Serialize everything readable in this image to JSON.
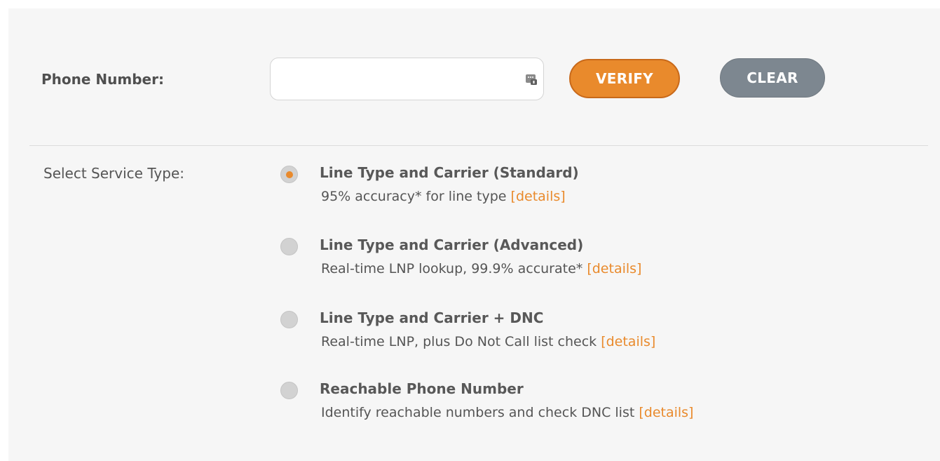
{
  "form": {
    "phone_label": "Phone Number:",
    "phone_value": "",
    "phone_placeholder": "",
    "contact_icon": "contact-card-icon",
    "verify_label": "VERIFY",
    "clear_label": "CLEAR"
  },
  "service": {
    "label": "Select Service Type:",
    "options": [
      {
        "title": "Line Type and Carrier (Standard)",
        "description": "95% accuracy* for line type",
        "link": "[details]",
        "selected": true
      },
      {
        "title": "Line Type and Carrier (Advanced)",
        "description": "Real-time LNP lookup, 99.9% accurate*",
        "link": "[details]",
        "selected": false
      },
      {
        "title": "Line Type and Carrier + DNC",
        "description": "Real-time LNP, plus Do Not Call list check",
        "link": "[details]",
        "selected": false
      },
      {
        "title": "Reachable Phone Number",
        "description": "Identify reachable numbers and check DNC list",
        "link": "[details]",
        "selected": false
      }
    ]
  },
  "colors": {
    "accent": "#e98a2c",
    "clear_button": "#7d8790",
    "panel_background": "#f6f6f6"
  }
}
